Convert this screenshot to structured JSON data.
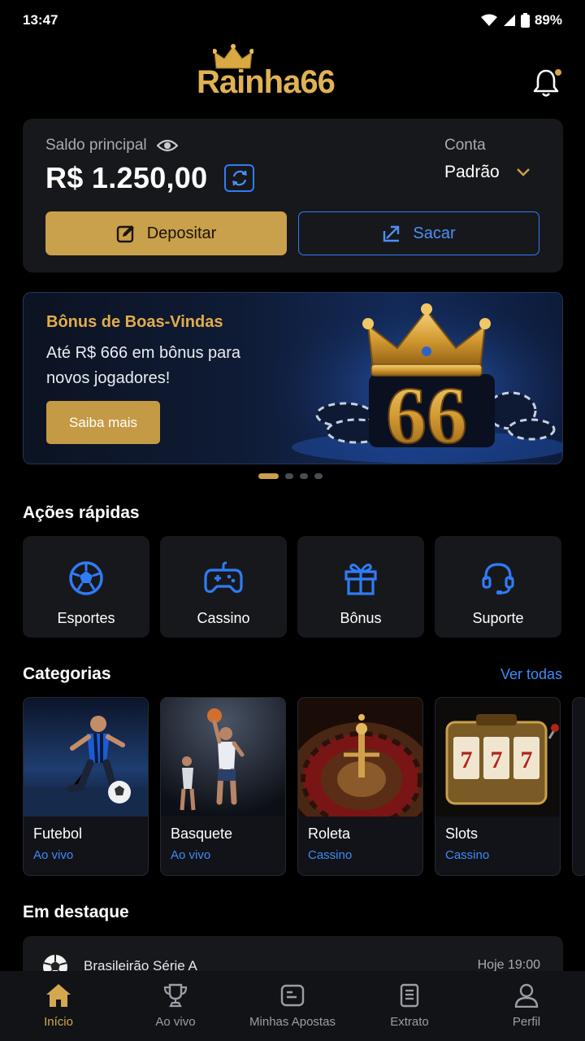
{
  "status_bar": {
    "time": "13:47",
    "battery": "89%"
  },
  "header": {
    "logo_text": "Rainha66"
  },
  "balance": {
    "label": "Saldo principal",
    "value": "R$ 1.250,00",
    "account_label": "Conta",
    "account_value": "Padrão",
    "deposit_label": "Depositar",
    "withdraw_label": "Sacar"
  },
  "promo": {
    "title": "Bônus de Boas-Vindas",
    "text": "Até R$ 666 em bônus para novos jogadores!",
    "button": "Saiba mais",
    "art_number": "66",
    "slides": 4,
    "active_slide": 1
  },
  "quick_actions": {
    "title": "Ações rápidas",
    "items": [
      {
        "label": "Esportes",
        "icon": "soccer-ball-icon"
      },
      {
        "label": "Cassino",
        "icon": "gamepad-icon"
      },
      {
        "label": "Bônus",
        "icon": "gift-icon"
      },
      {
        "label": "Suporte",
        "icon": "headset-icon"
      }
    ]
  },
  "categories": {
    "title": "Categorias",
    "see_all": "Ver todas",
    "items": [
      {
        "name": "Futebol",
        "sub": "Ao vivo"
      },
      {
        "name": "Basquete",
        "sub": "Ao vivo"
      },
      {
        "name": "Roleta",
        "sub": "Cassino"
      },
      {
        "name": "Slots",
        "sub": "Cassino"
      }
    ]
  },
  "featured": {
    "title": "Em destaque",
    "league": "Brasileirão Série A",
    "time": "Hoje 19:00"
  },
  "bottom_nav": {
    "items": [
      {
        "label": "Início",
        "icon": "home-icon",
        "active": true
      },
      {
        "label": "Ao vivo",
        "icon": "trophy-icon",
        "active": false
      },
      {
        "label": "Minhas Apostas",
        "icon": "ticket-icon",
        "active": false
      },
      {
        "label": "Extrato",
        "icon": "document-icon",
        "active": false
      },
      {
        "label": "Perfil",
        "icon": "user-icon",
        "active": false
      }
    ]
  },
  "colors": {
    "gold": "#c9a04b",
    "blue": "#2f7cf6",
    "card": "#17181c",
    "background": "#000000"
  }
}
